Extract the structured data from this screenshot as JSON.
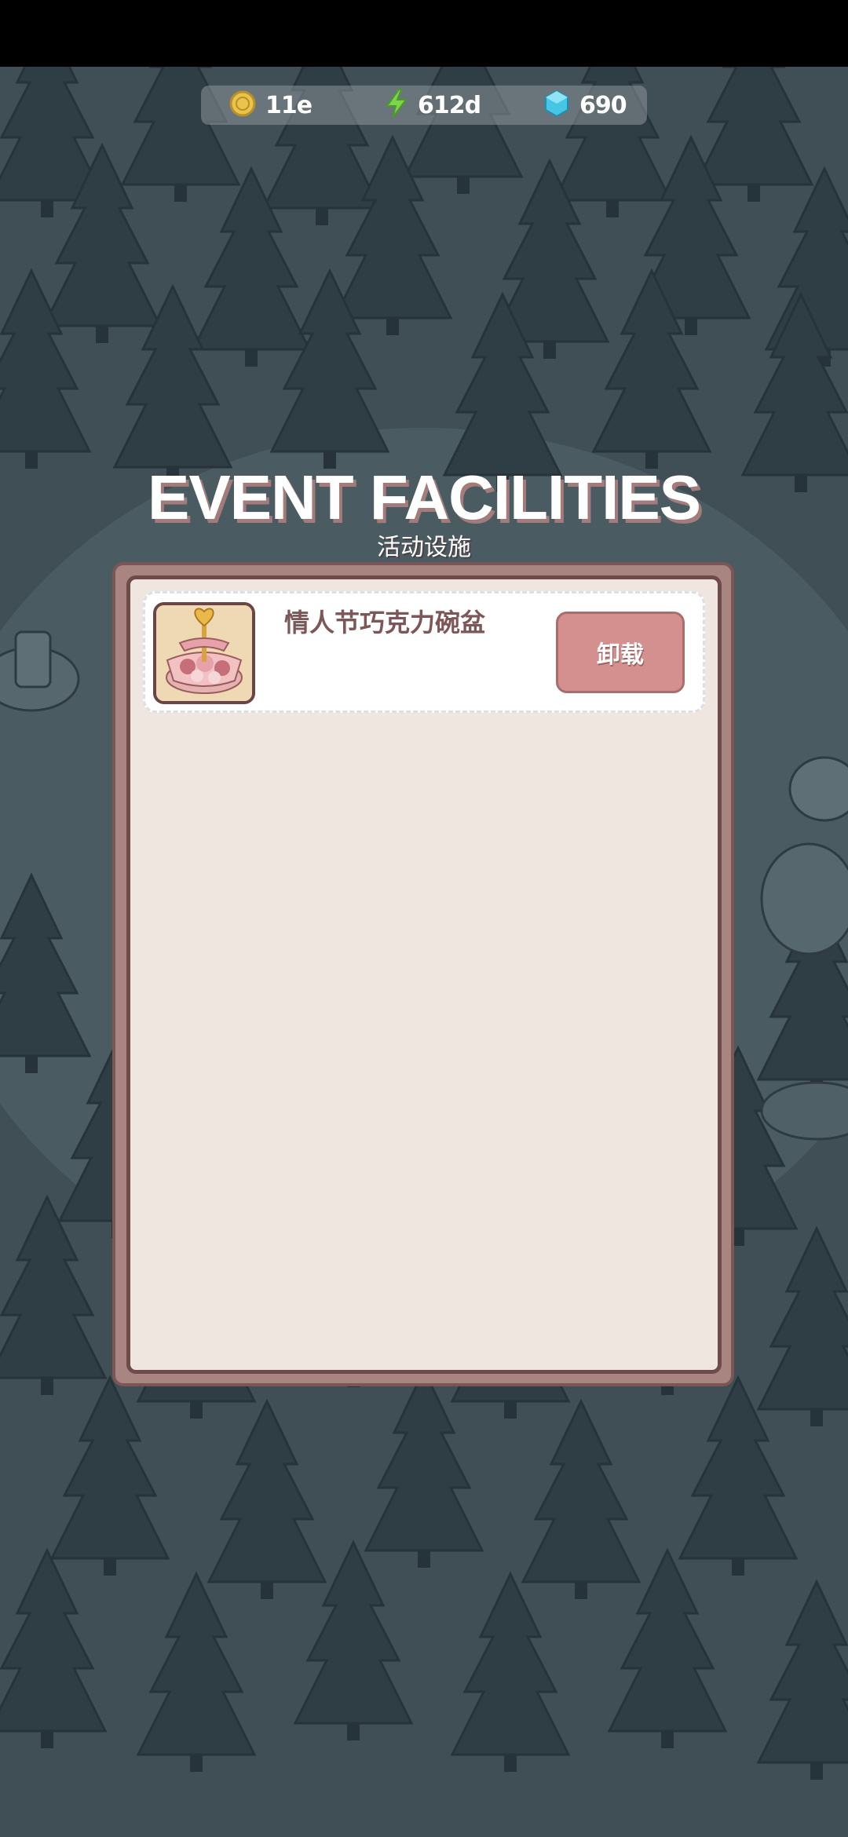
{
  "currency": {
    "coins": {
      "value": "11e",
      "icon": "coin-icon",
      "color": "#e9c34a"
    },
    "energy": {
      "value": "612d",
      "icon": "lightning-icon",
      "color": "#7bd44a"
    },
    "gems": {
      "value": "690",
      "icon": "gem-icon",
      "color": "#45c6e6"
    }
  },
  "header": {
    "title": "EVENT FACILITIES",
    "subtitle": "活动设施"
  },
  "facilities": [
    {
      "name": "情人节巧克力碗盆",
      "icon": "valentine-chocolate-bowl-icon",
      "action_label": "卸载"
    }
  ],
  "colors": {
    "panel_border": "#7c5556",
    "panel_bg": "#efe7df",
    "button_bg": "#d4908f",
    "text_brown": "#7d5757",
    "background": "#3f4f55"
  }
}
